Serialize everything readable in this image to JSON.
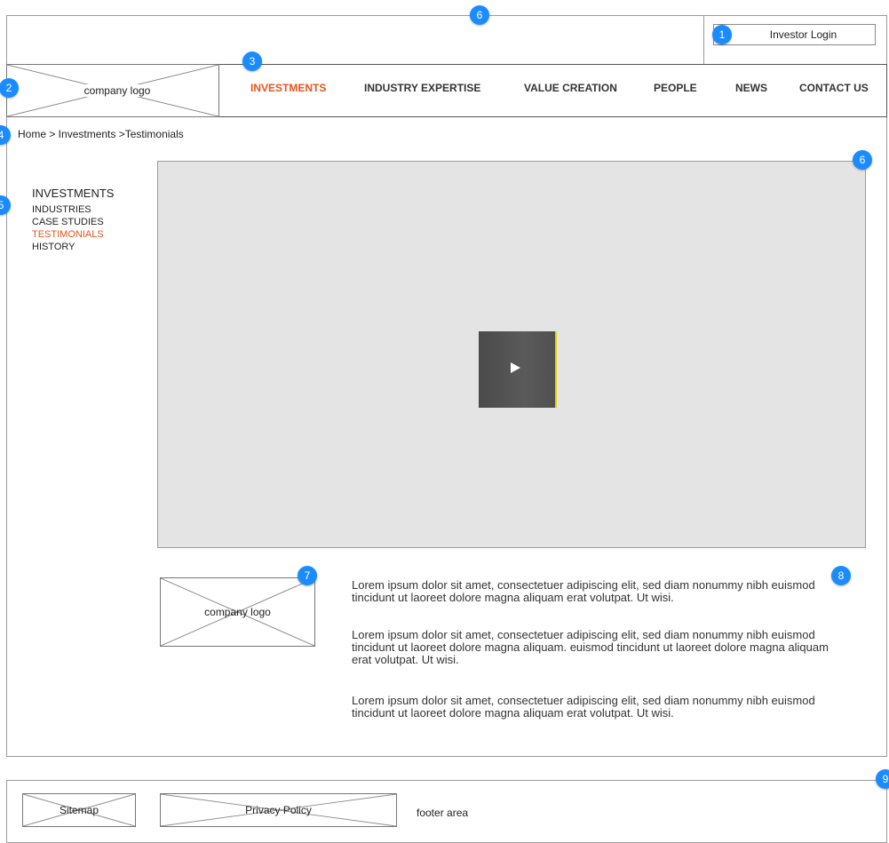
{
  "header": {
    "investor_login": "Investor Login",
    "logo_label": "company logo"
  },
  "nav": {
    "items": [
      {
        "label": "INVESTMENTS",
        "active": true
      },
      {
        "label": "INDUSTRY EXPERTISE",
        "active": false
      },
      {
        "label": "VALUE CREATION",
        "active": false
      },
      {
        "label": "PEOPLE",
        "active": false
      },
      {
        "label": "NEWS",
        "active": false
      },
      {
        "label": "CONTACT US",
        "active": false
      }
    ]
  },
  "breadcrumb": "Home > Investments >Testimonials",
  "sidebar": {
    "title": "INVESTMENTS",
    "items": [
      {
        "label": "INDUSTRIES"
      },
      {
        "label": "CASE STUDIES"
      },
      {
        "label": "TESTIMONIALS",
        "active": true
      },
      {
        "label": "HISTORY"
      }
    ]
  },
  "testimonial": {
    "logo_label": "company logo",
    "paragraphs": [
      "Lorem ipsum dolor sit amet, consectetuer adipiscing elit, sed diam nonummy nibh euismod tincidunt ut laoreet dolore magna aliquam erat volutpat. Ut wisi.",
      "Lorem ipsum dolor sit amet, consectetuer adipiscing elit, sed diam nonummy nibh euismod tincidunt ut laoreet dolore magna aliquam. euismod tincidunt ut laoreet dolore magna aliquam erat volutpat. Ut wisi.",
      "Lorem ipsum dolor sit amet, consectetuer adipiscing elit, sed diam nonummy nibh euismod tincidunt ut laoreet dolore magna aliquam erat volutpat. Ut wisi."
    ]
  },
  "footer": {
    "sitemap": "Sitemap",
    "privacy": "Privacy Policy",
    "area_label": "footer area"
  },
  "annotations": {
    "b1": "1",
    "b2": "2",
    "b3": "3",
    "b4": "4",
    "b5": "5",
    "b6a": "6",
    "b6b": "6",
    "b7": "7",
    "b8": "8",
    "b9": "9"
  },
  "colors": {
    "accent": "#e8541e",
    "badge": "#1a8cff",
    "video_bg": "#e4e4e4",
    "play_bg": "#4a4a4a"
  },
  "icons": {
    "play": "play-icon"
  }
}
